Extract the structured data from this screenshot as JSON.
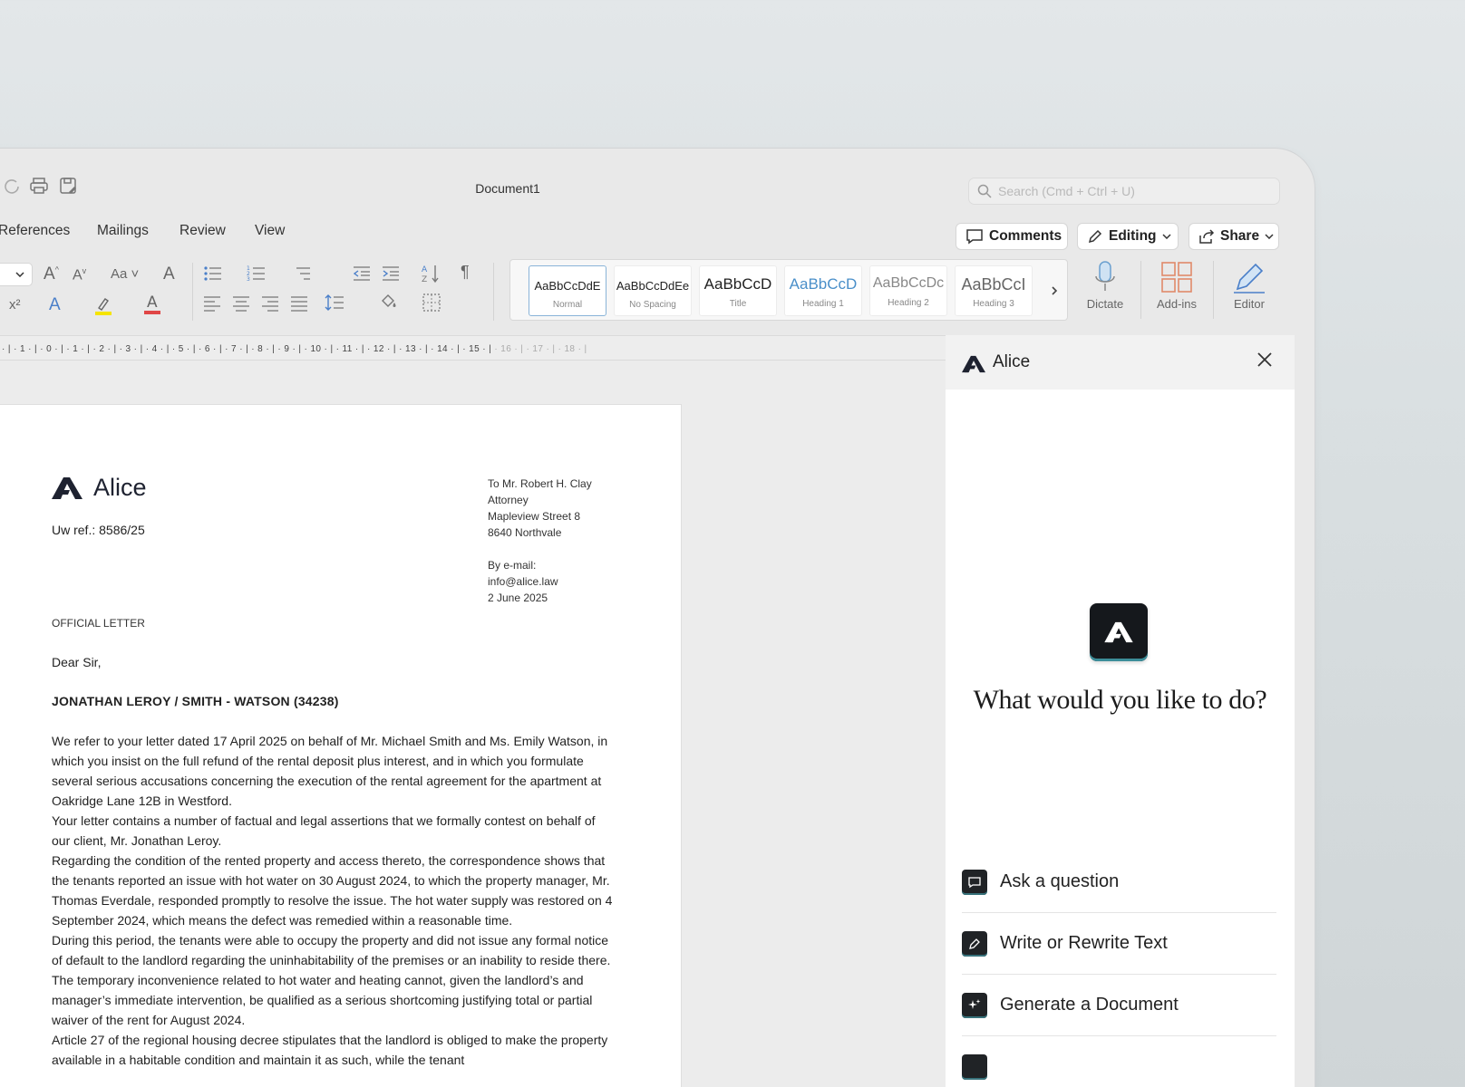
{
  "window": {
    "title": "Document1",
    "search_placeholder": "Search (Cmd + Ctrl + U)"
  },
  "menu": [
    "References",
    "Mailings",
    "Review",
    "View"
  ],
  "header_buttons": {
    "comments": "Comments",
    "editing": "Editing",
    "share": "Share"
  },
  "ribbon": {
    "styles": [
      {
        "sample": "AaBbCcDdE",
        "name": "Normal",
        "color": "#333333"
      },
      {
        "sample": "AaBbCcDdEe",
        "name": "No Spacing",
        "color": "#333333"
      },
      {
        "sample": "AaBbCcD",
        "name": "Title",
        "color": "#333333"
      },
      {
        "sample": "AaBbCcD",
        "name": "Heading 1",
        "color": "#4a8fc9"
      },
      {
        "sample": "AaBbCcDc",
        "name": "Heading 2",
        "color": "#777777"
      },
      {
        "sample": "AaBbCcI",
        "name": "Heading 3",
        "color": "#666666"
      }
    ],
    "dictate": "Dictate",
    "addins": "Add-ins",
    "editor": "Editor"
  },
  "ruler": {
    "marks": "· | · 1 · | · 0 · | · 1 · | · 2 · | · 3 · | · 4 · | · 5 · | · 6 · | · 7 · | · 8 · | · 9 · | · 10 · | · 11 · | · 12 · | · 13 · | · 14 · | · 15 · |",
    "marks_dim": " · 16 · | · 17 · | · 18 · |"
  },
  "letter": {
    "logo": "Alice",
    "reference": "Uw ref.: 8586/25",
    "recipient": [
      "To Mr. Robert H. Clay",
      "Attorney",
      "Mapleview Street 8",
      "8640 Northvale"
    ],
    "delivery": [
      "By e-mail:",
      "info@alice.law",
      "2 June 2025"
    ],
    "kind": "OFFICIAL LETTER",
    "salutation": "Dear Sir,",
    "subject": "JONATHAN LEROY / SMITH - WATSON (34238)",
    "paragraphs": [
      "We refer to your letter dated 17 April 2025 on behalf of Mr. Michael Smith and Ms. Emily Watson, in which you insist on the full refund of the rental deposit plus interest, and in which you formulate several serious accusations concerning the execution of the rental agreement for the apartment at Oakridge Lane 12B in Westford.",
      "Your letter contains a number of factual and legal assertions that we formally contest on behalf of our client, Mr. Jonathan Leroy.",
      "Regarding the condition of the rented property and access thereto, the correspondence shows that the tenants reported an issue with hot water on 30 August 2024, to which the property manager, Mr. Thomas Everdale, responded promptly to resolve the issue. The hot water supply was restored on 4 September 2024, which means the defect was remedied within a reasonable time.",
      "During this period, the tenants were able to occupy the property and did not issue any formal notice of default to the landlord regarding the uninhabitability of the premises or an inability to reside there. The temporary inconvenience related to hot water and heating cannot, given the landlord’s and manager’s immediate intervention, be qualified as a serious shortcoming justifying total or partial waiver of the rent for August 2024.",
      "Article 27 of the regional housing decree stipulates that the landlord is obliged to make the property available in a habitable condition and maintain it as such, while the tenant"
    ]
  },
  "panel": {
    "title": "Alice",
    "question": "What would you like to do?",
    "actions": [
      {
        "label": "Ask a question",
        "icon": "chat-icon"
      },
      {
        "label": "Write or Rewrite Text",
        "icon": "pencil-icon"
      },
      {
        "label": "Generate a Document",
        "icon": "sparkle-icon"
      }
    ]
  }
}
